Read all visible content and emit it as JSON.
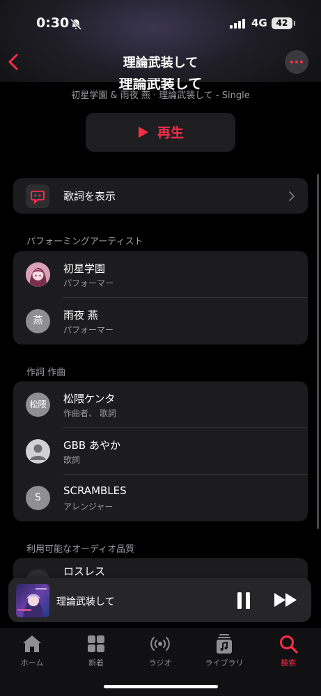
{
  "status": {
    "time": "0:30",
    "network": "4G",
    "battery": "42"
  },
  "nav": {
    "title": "理論武装して"
  },
  "album": {
    "title": "理論武装して",
    "subtitle": "初星学園 & 雨夜 燕 · 理論武装して - Single",
    "play_label": "再生"
  },
  "lyrics": {
    "label": "歌詞を表示"
  },
  "sections": {
    "performers": "パフォーミングアーティスト",
    "writers": "作詞 作曲",
    "quality": "利用可能なオーディオ品質"
  },
  "performers": [
    {
      "name": "初星学園",
      "role": "パフォーマー",
      "avatar": ""
    },
    {
      "name": "雨夜 燕",
      "role": "パフォーマー",
      "avatar": "燕"
    }
  ],
  "writers": [
    {
      "name": "松隈ケンタ",
      "role": "作曲者、 歌詞",
      "avatar": "松隈"
    },
    {
      "name": "GBB あやか",
      "role": "歌詞",
      "avatar": ""
    },
    {
      "name": "SCRAMBLES",
      "role": "アレンジャー",
      "avatar": "S"
    }
  ],
  "quality": [
    {
      "name": "ロスレス"
    }
  ],
  "mini_player": {
    "title": "理論武装して"
  },
  "tabs": [
    {
      "label": "ホーム",
      "icon": "home-icon"
    },
    {
      "label": "新着",
      "icon": "grid-icon"
    },
    {
      "label": "ラジオ",
      "icon": "radio-icon"
    },
    {
      "label": "ライブラリ",
      "icon": "library-icon"
    },
    {
      "label": "検索",
      "icon": "search-icon",
      "active": true
    }
  ],
  "colors": {
    "accent": "#fa2d48",
    "card": "#1c1c1e",
    "background": "#000000"
  }
}
